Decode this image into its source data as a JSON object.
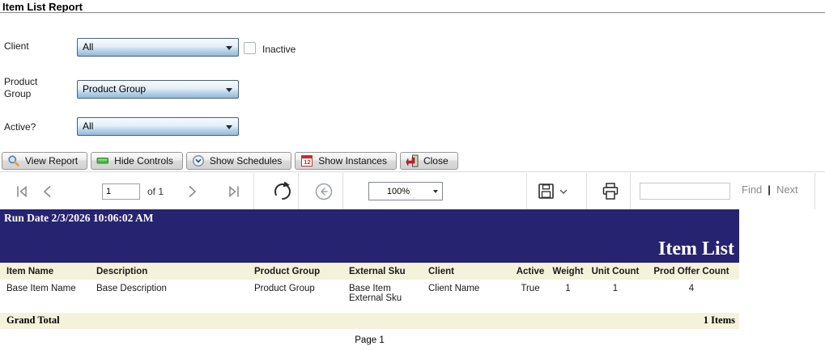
{
  "page": {
    "title": "Item List Report"
  },
  "filters": {
    "client_label": "Client",
    "client_value": "All",
    "inactive_label": "Inactive",
    "inactive_checked": false,
    "product_group_label": "Product Group",
    "product_group_value": "Product Group",
    "active_label": "Active?",
    "active_value": "All"
  },
  "action_buttons": [
    {
      "label": "View Report",
      "icon": "magnifier-icon"
    },
    {
      "label": "Hide Controls",
      "icon": "window-bar-icon"
    },
    {
      "label": "Show Schedules",
      "icon": "clock-icon"
    },
    {
      "label": "Show Instances",
      "icon": "calendar-icon"
    },
    {
      "label": "Close",
      "icon": "exit-door-icon"
    }
  ],
  "viewer_toolbar": {
    "current_page": "1",
    "of_label": "of 1",
    "zoom_level": "100%",
    "search_value": "",
    "find_label": "Find",
    "next_label": "Next"
  },
  "report": {
    "run_date": "Run Date 2/3/2026 10:06:02 AM",
    "title": "Item List",
    "columns": [
      "Item Name",
      "Description",
      "Product Group",
      "External Sku",
      "Client",
      "Active",
      "Weight",
      "Unit Count",
      "Prod Offer Count"
    ],
    "rows": [
      [
        "Base Item Name",
        "Base Description",
        "Product Group",
        "Base Item External Sku",
        "Client Name",
        "True",
        "1",
        "1",
        "4"
      ]
    ],
    "grand_total_label": "Grand Total",
    "grand_total_value": "1 Items",
    "page_footer": "Page 1"
  },
  "colors": {
    "report_header_bg": "#262370",
    "report_band_bg": "#f5f2db"
  }
}
